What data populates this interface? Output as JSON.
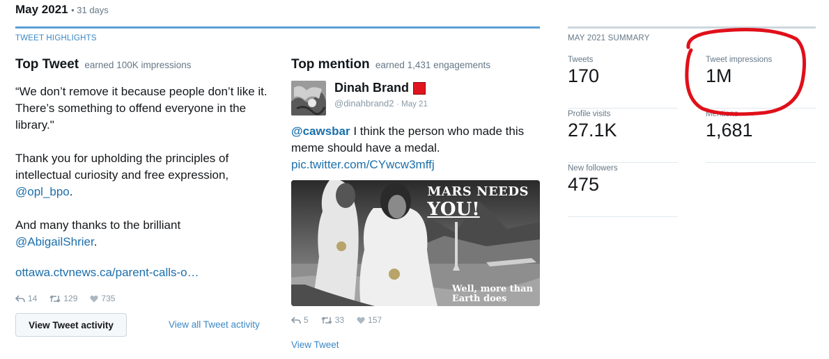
{
  "period": {
    "month": "May 2021",
    "days": "• 31 days"
  },
  "highlights": {
    "header": "TWEET HIGHLIGHTS"
  },
  "top_tweet": {
    "title": "Top Tweet",
    "subtitle": "earned 100K impressions",
    "quote": "“We don’t remove it because people don’t like it. There’s something to offend everyone in the library.\"",
    "para2_text": "Thank you for upholding the principles of intellectual curiosity and free expression,",
    "para2_mention": "@opl_bpo",
    "para2_end": ".",
    "para3_text": "And many thanks to the brilliant",
    "para3_mention": "@AbigailShrier",
    "para3_end": ".",
    "link": "ottawa.ctvnews.ca/parent-calls-o…",
    "replies": "14",
    "retweets": "129",
    "likes": "735",
    "activity_button": "View Tweet activity",
    "view_all_link": "View all Tweet activity"
  },
  "top_mention": {
    "title": "Top mention",
    "subtitle": "earned 1,431 engagements",
    "author_name": "Dinah Brand",
    "author_handle": "@dinahbrand2",
    "date": "May 21",
    "mention": "@cawsbar",
    "text": "I think the person who made this meme should have a medal.",
    "link": "pic.twitter.com/CYwcw3mffj",
    "meme_line1": "MARS NEEDS",
    "meme_line2": "YOU!",
    "meme_footer1": "Well, more than",
    "meme_footer2": "Earth does",
    "replies": "5",
    "retweets": "33",
    "likes": "157",
    "view_tweet": "View Tweet"
  },
  "summary": {
    "header": "MAY 2021 SUMMARY",
    "tweets_label": "Tweets",
    "tweets_value": "170",
    "impressions_label": "Tweet impressions",
    "impressions_value": "1M",
    "profile_visits_label": "Profile visits",
    "profile_visits_value": "27.1K",
    "mentions_label": "Mentions",
    "mentions_value": "1,681",
    "new_followers_label": "New followers",
    "new_followers_value": "475"
  },
  "colors": {
    "accent": "#5b9fd4",
    "link": "#1b6fab",
    "annotation_circle": "#e0101a",
    "badge": "#e0141e"
  }
}
